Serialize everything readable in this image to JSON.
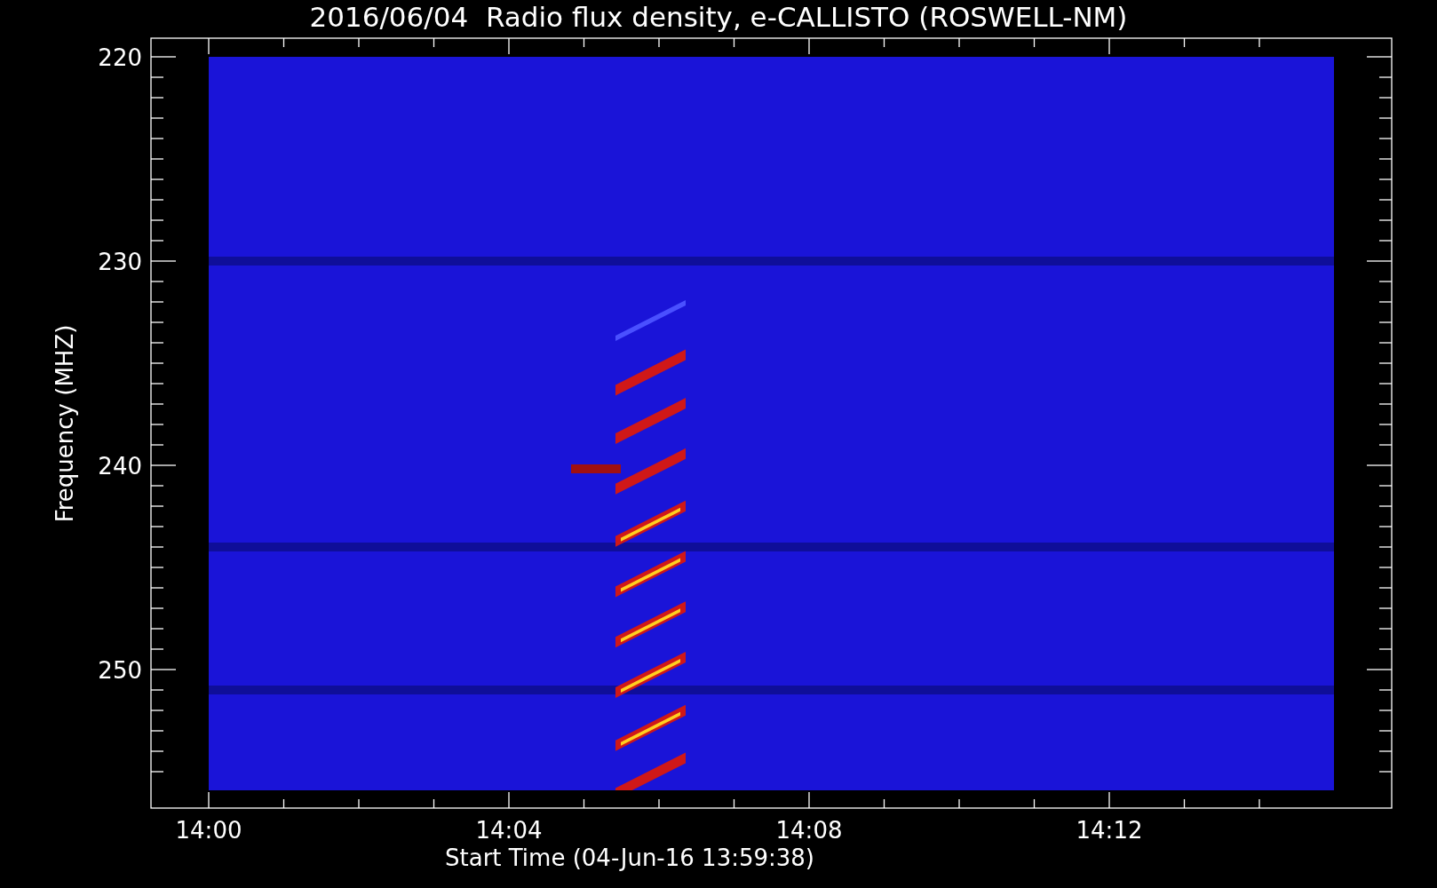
{
  "chart": {
    "title": "2016/06/04  Radio flux density, e-CALLISTO (ROSWELL-NM)",
    "y_axis": {
      "title": "Frequency (MHZ)",
      "ticks": [
        "220",
        "230",
        "240",
        "250"
      ]
    },
    "x_axis": {
      "title": "Start Time (04-Jun-16 13:59:38)",
      "ticks": [
        "14:00",
        "14:04",
        "14:08",
        "14:12"
      ]
    }
  }
}
